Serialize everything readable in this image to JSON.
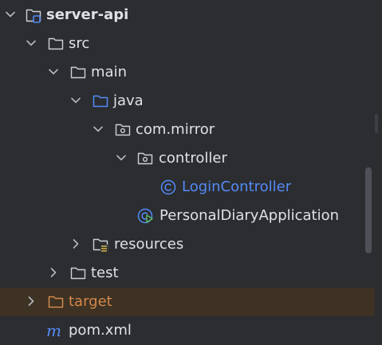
{
  "project_tree": {
    "root": {
      "label": "server-api",
      "expanded": true,
      "icon": "module-folder-icon"
    },
    "src": {
      "label": "src",
      "expanded": true,
      "icon": "folder-icon"
    },
    "main": {
      "label": "main",
      "expanded": true,
      "icon": "folder-icon"
    },
    "java": {
      "label": "java",
      "expanded": true,
      "icon": "source-folder-icon"
    },
    "package": {
      "label": "com.mirror",
      "expanded": true,
      "icon": "package-icon"
    },
    "controller": {
      "label": "controller",
      "expanded": true,
      "icon": "package-icon"
    },
    "login_controller": {
      "label": "LoginController",
      "icon": "class-icon"
    },
    "app_class": {
      "label": "PersonalDiaryApplication",
      "icon": "spring-boot-class-icon"
    },
    "resources": {
      "label": "resources",
      "expanded": false,
      "icon": "resources-folder-icon"
    },
    "test": {
      "label": "test",
      "expanded": false,
      "icon": "folder-icon"
    },
    "target": {
      "label": "target",
      "expanded": false,
      "icon": "excluded-folder-icon"
    },
    "pom": {
      "label": "pom.xml",
      "icon": "maven-icon"
    }
  },
  "colors": {
    "background": "#2b2d30",
    "text": "#dfe1e5",
    "accent_blue": "#548af7",
    "excluded_orange": "#d4874b",
    "excluded_row_bg": "#3d3223"
  }
}
